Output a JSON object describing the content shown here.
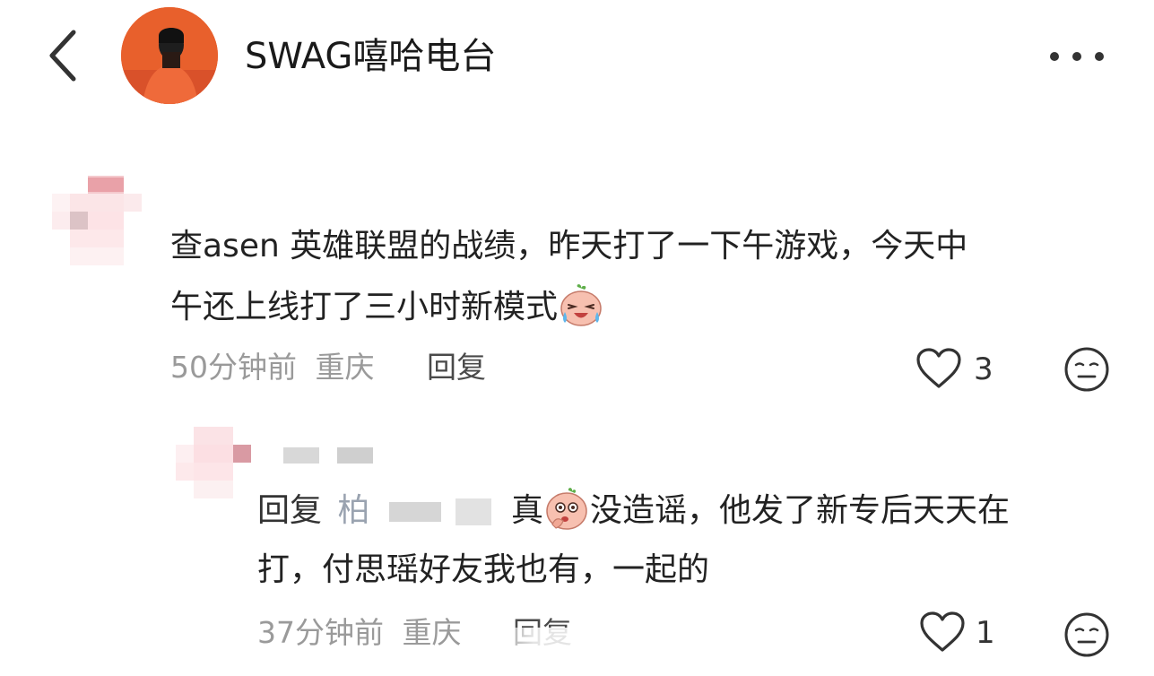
{
  "header": {
    "title": "SWAG嘻哈电台"
  },
  "comment": {
    "line1": "查asen 英雄联盟的战绩，昨天打了一下午游戏，今天中",
    "line2": "午还上线打了三小时新模式",
    "time": "50分钟前",
    "location": "重庆",
    "reply_label": "回复",
    "likes": "3"
  },
  "reply": {
    "prefix": "回复",
    "target": "柏",
    "line1_rest": "真",
    "line1_after": "没造谣，他发了新专后天天在",
    "line2": "打，付思瑶好友我也有，一起的",
    "time": "37分钟前",
    "location": "重庆",
    "reply_label": "回复",
    "likes": "1"
  },
  "icons": {
    "back": "chevron-left-icon",
    "more": "more-dots-icon",
    "like": "heart-outline-icon",
    "face": "speechless-face-icon",
    "emoji1": "crying-laugh-emoji",
    "emoji2": "thinking-emoji"
  }
}
